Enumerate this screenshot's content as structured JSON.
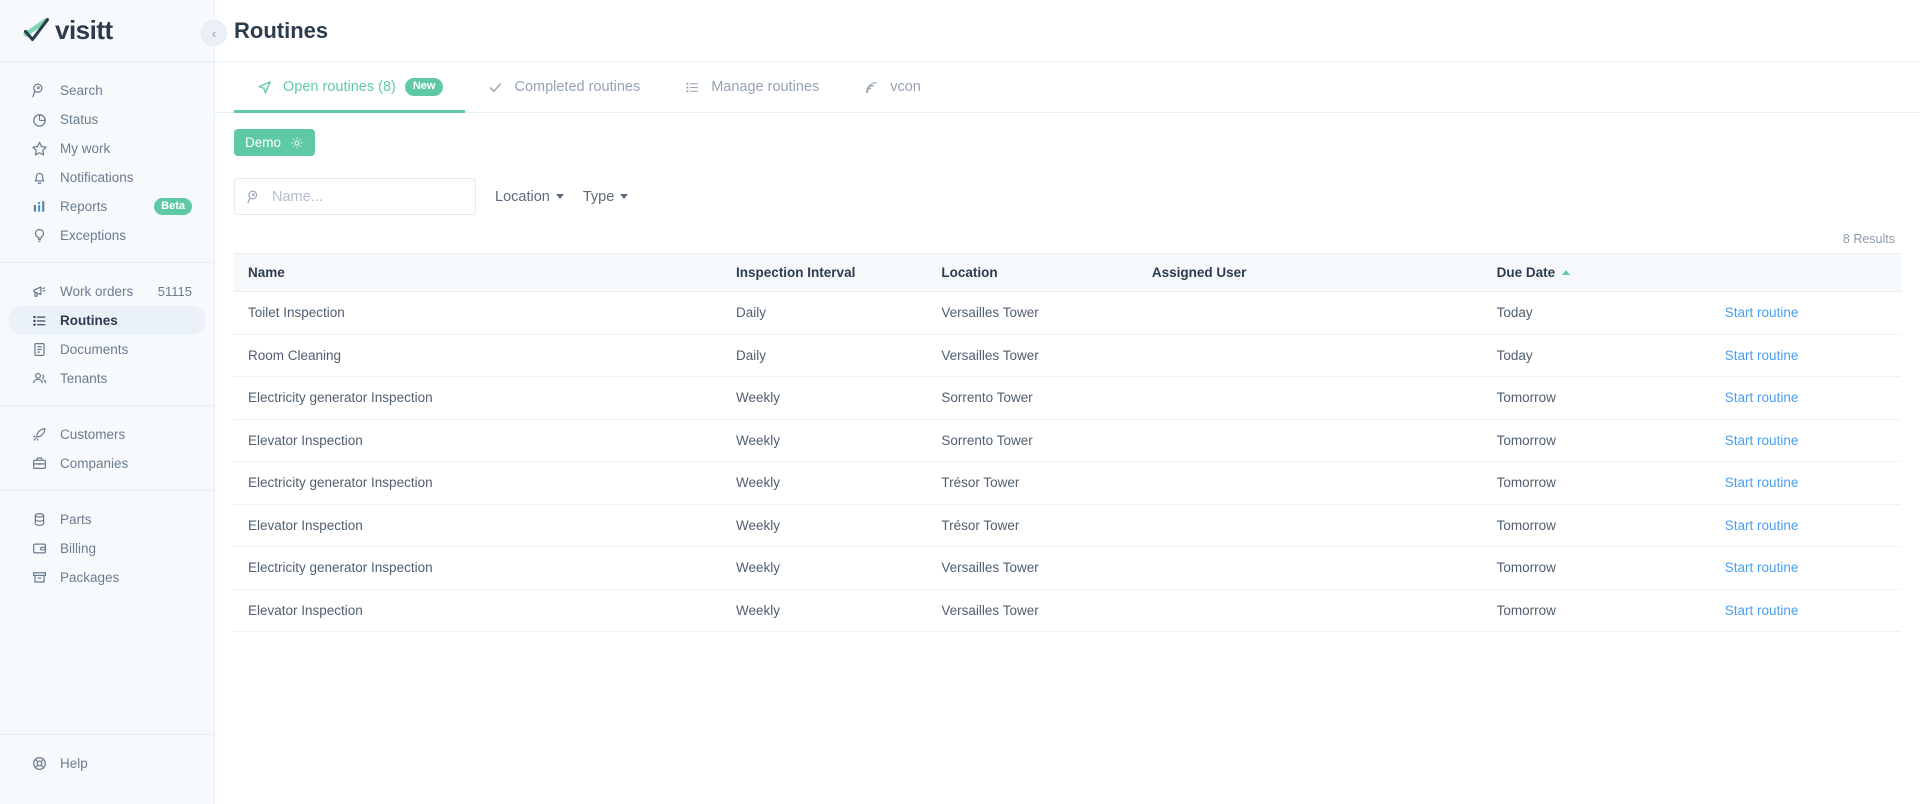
{
  "brand": {
    "name": "visitt",
    "logo_icon": "visitt-check-logo"
  },
  "sidebar": {
    "collapse_icon": "chevron-left-icon",
    "groups": [
      {
        "items": [
          {
            "label": "Search",
            "icon": "search-icon"
          },
          {
            "label": "Status",
            "icon": "pie-chart-icon"
          },
          {
            "label": "My work",
            "icon": "star-icon"
          },
          {
            "label": "Notifications",
            "icon": "bell-icon"
          },
          {
            "label": "Reports",
            "icon": "bar-chart-icon",
            "badge": "Beta"
          },
          {
            "label": "Exceptions",
            "icon": "lightbulb-icon"
          }
        ]
      },
      {
        "items": [
          {
            "label": "Work orders",
            "icon": "megaphone-icon",
            "count": "51115"
          },
          {
            "label": "Routines",
            "icon": "list-icon",
            "active": true
          },
          {
            "label": "Documents",
            "icon": "document-icon"
          },
          {
            "label": "Tenants",
            "icon": "users-icon"
          }
        ]
      },
      {
        "items": [
          {
            "label": "Customers",
            "icon": "rocket-icon"
          },
          {
            "label": "Companies",
            "icon": "briefcase-icon"
          }
        ]
      },
      {
        "items": [
          {
            "label": "Parts",
            "icon": "database-icon"
          },
          {
            "label": "Billing",
            "icon": "wallet-icon"
          },
          {
            "label": "Packages",
            "icon": "package-icon"
          }
        ]
      },
      {
        "items": [
          {
            "label": "Help",
            "icon": "lifebuoy-icon"
          }
        ]
      }
    ]
  },
  "header": {
    "title": "Routines"
  },
  "tabs": [
    {
      "label": "Open routines (8)",
      "icon": "navigation-arrow-icon",
      "badge": "New",
      "active": true
    },
    {
      "label": "Completed routines",
      "icon": "check-icon",
      "active": false
    },
    {
      "label": "Manage routines",
      "icon": "list-icon",
      "active": false
    },
    {
      "label": "vcon",
      "icon": "rss-icon",
      "active": false
    }
  ],
  "toolbar": {
    "demo_label": "Demo",
    "demo_icon": "gear-icon"
  },
  "filters": {
    "search_placeholder": "Name...",
    "search_value": "",
    "search_icon": "search-icon",
    "location_label": "Location",
    "type_label": "Type"
  },
  "results_count": "8 Results",
  "table": {
    "columns": [
      {
        "key": "name",
        "label": "Name"
      },
      {
        "key": "interval",
        "label": "Inspection Interval"
      },
      {
        "key": "location",
        "label": "Location"
      },
      {
        "key": "user",
        "label": "Assigned User"
      },
      {
        "key": "due",
        "label": "Due Date",
        "sorted": "asc"
      },
      {
        "key": "action",
        "label": ""
      }
    ],
    "action_label": "Start routine",
    "rows": [
      {
        "name": "Toilet Inspection",
        "interval": "Daily",
        "location": "Versailles Tower",
        "user": "",
        "due": "Today",
        "due_state": "today"
      },
      {
        "name": "Room Cleaning",
        "interval": "Daily",
        "location": "Versailles Tower",
        "user": "",
        "due": "Today",
        "due_state": "today"
      },
      {
        "name": "Electricity generator Inspection",
        "interval": "Weekly",
        "location": "Sorrento Tower",
        "user": "",
        "due": "Tomorrow",
        "due_state": "tomorrow"
      },
      {
        "name": "Elevator Inspection",
        "interval": "Weekly",
        "location": "Sorrento Tower",
        "user": "",
        "due": "Tomorrow",
        "due_state": "tomorrow"
      },
      {
        "name": "Electricity generator Inspection",
        "interval": "Weekly",
        "location": "Trésor Tower",
        "user": "",
        "due": "Tomorrow",
        "due_state": "tomorrow"
      },
      {
        "name": "Elevator Inspection",
        "interval": "Weekly",
        "location": "Trésor Tower",
        "user": "",
        "due": "Tomorrow",
        "due_state": "tomorrow"
      },
      {
        "name": "Electricity generator Inspection",
        "interval": "Weekly",
        "location": "Versailles Tower",
        "user": "",
        "due": "Tomorrow",
        "due_state": "tomorrow"
      },
      {
        "name": "Elevator Inspection",
        "interval": "Weekly",
        "location": "Versailles Tower",
        "user": "",
        "due": "Tomorrow",
        "due_state": "tomorrow"
      }
    ]
  },
  "colors": {
    "accent": "#5fc9a6",
    "due_today": "#f4606c",
    "due_tomorrow": "#f5a623",
    "link": "#4a9ef0",
    "sidebar_bg": "#f7fafc",
    "text_dark": "#2c3b4d"
  }
}
